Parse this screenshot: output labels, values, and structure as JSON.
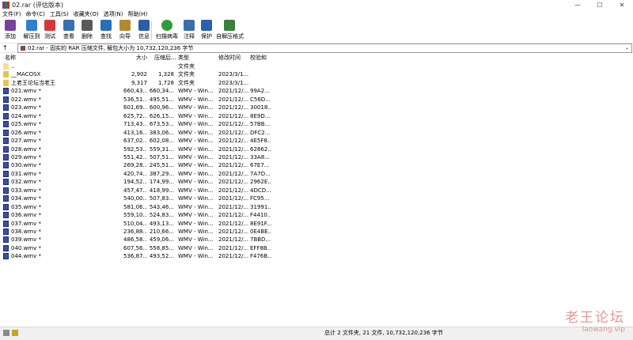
{
  "window": {
    "title": "02.rar (评估版本)"
  },
  "window_buttons": {
    "minimize": "—",
    "maximize": "☐",
    "close": "✕"
  },
  "menu": [
    "文件(F)",
    "命令(C)",
    "工具(S)",
    "收藏夹(O)",
    "选项(N)",
    "帮助(H)"
  ],
  "toolbar": [
    {
      "label": "添加",
      "icon": "add-archive-icon",
      "color": "#7b3fa0"
    },
    {
      "label": "解压到",
      "icon": "extract-to-icon",
      "color": "#2f7fd0"
    },
    {
      "label": "测试",
      "icon": "test-icon",
      "color": "#d13b3b"
    },
    {
      "label": "查看",
      "icon": "view-icon",
      "color": "#3a6fb0"
    },
    {
      "label": "删除",
      "icon": "delete-icon",
      "color": "#5a5a5a"
    },
    {
      "label": "查找",
      "icon": "find-icon",
      "color": "#2b6fb8"
    },
    {
      "label": "向导",
      "icon": "wizard-icon",
      "color": "#b08a2e"
    },
    {
      "label": "信息",
      "icon": "info-icon",
      "color": "#2b5fa8"
    },
    {
      "label": "扫描病毒",
      "icon": "virus-scan-icon",
      "color": "#2e9d3a"
    },
    {
      "label": "注释",
      "icon": "comment-icon",
      "color": "#3b6fa8"
    },
    {
      "label": "保护",
      "icon": "protect-icon",
      "color": "#2b5fb0"
    },
    {
      "label": "自解压格式",
      "icon": "sfx-icon",
      "color": "#3a7f3a"
    }
  ],
  "address": {
    "up": "↑",
    "text": "02.rar - 固实的 RAR 压缩文件, 解包大小为 10,732,120,236 字节",
    "chevron": "⌄"
  },
  "columns": [
    "名称",
    "大小",
    "压缩后...",
    "类型",
    "修改时间",
    "校验和"
  ],
  "rows": [
    {
      "icon": "parent",
      "name": "..",
      "size": "",
      "packed": "",
      "type": "文件夹",
      "modified": "",
      "crc": ""
    },
    {
      "icon": "folder",
      "name": "__MACOSX",
      "size": "2,902",
      "packed": "1,328",
      "type": "文件夹",
      "modified": "2023/3/1...",
      "crc": ""
    },
    {
      "icon": "folder",
      "name": "上老王论坛当老王",
      "size": "9,317",
      "packed": "1,728",
      "type": "文件夹",
      "modified": "2023/3/1...",
      "crc": ""
    },
    {
      "icon": "wmv",
      "name": "021.wmv *",
      "size": "660,43...",
      "packed": "660,34...",
      "type": "WMV - Win...",
      "modified": "2021/12/...",
      "crc": "99A2..."
    },
    {
      "icon": "wmv",
      "name": "022.wmv *",
      "size": "536,51...",
      "packed": "495,51...",
      "type": "WMV - Win...",
      "modified": "2021/12/...",
      "crc": "C56D..."
    },
    {
      "icon": "wmv",
      "name": "023.wmv *",
      "size": "601,69...",
      "packed": "600,96...",
      "type": "WMV - Win...",
      "modified": "2021/12/...",
      "crc": "30018..."
    },
    {
      "icon": "wmv",
      "name": "024.wmv *",
      "size": "625,72...",
      "packed": "626,15...",
      "type": "WMV - Win...",
      "modified": "2021/12/...",
      "crc": "8E9D..."
    },
    {
      "icon": "wmv",
      "name": "025.wmv *",
      "size": "713,43...",
      "packed": "673,53...",
      "type": "WMV - Win...",
      "modified": "2021/12/...",
      "crc": "57BB..."
    },
    {
      "icon": "wmv",
      "name": "026.wmv *",
      "size": "413,16...",
      "packed": "383,06...",
      "type": "WMV - Win...",
      "modified": "2021/12/...",
      "crc": "DFC2..."
    },
    {
      "icon": "wmv",
      "name": "027.wmv *",
      "size": "637,02...",
      "packed": "602,08...",
      "type": "WMV - Win...",
      "modified": "2021/12/...",
      "crc": "4E5F8..."
    },
    {
      "icon": "wmv",
      "name": "028.wmv *",
      "size": "592,53...",
      "packed": "559,31...",
      "type": "WMV - Win...",
      "modified": "2021/12/...",
      "crc": "62862..."
    },
    {
      "icon": "wmv",
      "name": "029.wmv *",
      "size": "551,42...",
      "packed": "507,51...",
      "type": "WMV - Win...",
      "modified": "2021/12/...",
      "crc": "33A8..."
    },
    {
      "icon": "wmv",
      "name": "030.wmv *",
      "size": "269,28...",
      "packed": "245,51...",
      "type": "WMV - Win...",
      "modified": "2021/12/...",
      "crc": "67E7..."
    },
    {
      "icon": "wmv",
      "name": "031.wmv *",
      "size": "420,74...",
      "packed": "387,29...",
      "type": "WMV - Win...",
      "modified": "2021/12/...",
      "crc": "7A7D..."
    },
    {
      "icon": "wmv",
      "name": "032.wmv *",
      "size": "194,52...",
      "packed": "174,99...",
      "type": "WMV - Win...",
      "modified": "2021/12/...",
      "crc": "2962E..."
    },
    {
      "icon": "wmv",
      "name": "033.wmv *",
      "size": "457,47...",
      "packed": "418,99...",
      "type": "WMV - Win...",
      "modified": "2021/12/...",
      "crc": "4DCD..."
    },
    {
      "icon": "wmv",
      "name": "034.wmv *",
      "size": "540,00...",
      "packed": "507,83...",
      "type": "WMV - Win...",
      "modified": "2021/12/...",
      "crc": "FC95..."
    },
    {
      "icon": "wmv",
      "name": "035.wmv *",
      "size": "581,06...",
      "packed": "543,46...",
      "type": "WMV - Win...",
      "modified": "2021/12/...",
      "crc": "31991..."
    },
    {
      "icon": "wmv",
      "name": "036.wmv *",
      "size": "559,10...",
      "packed": "524,83...",
      "type": "WMV - Win...",
      "modified": "2021/12/...",
      "crc": "F4410..."
    },
    {
      "icon": "wmv",
      "name": "037.wmv *",
      "size": "510,04...",
      "packed": "493,13...",
      "type": "WMV - Win...",
      "modified": "2021/12/...",
      "crc": "8E91F..."
    },
    {
      "icon": "wmv",
      "name": "038.wmv *",
      "size": "236,88...",
      "packed": "210,66...",
      "type": "WMV - Win...",
      "modified": "2021/12/...",
      "crc": "0E4BE..."
    },
    {
      "icon": "wmv",
      "name": "039.wmv *",
      "size": "486,58...",
      "packed": "459,06...",
      "type": "WMV - Win...",
      "modified": "2021/12/...",
      "crc": "7BBD..."
    },
    {
      "icon": "wmv",
      "name": "040.wmv *",
      "size": "607,56...",
      "packed": "558,85...",
      "type": "WMV - Win...",
      "modified": "2021/12/...",
      "crc": "EFF8B..."
    },
    {
      "icon": "wmv",
      "name": "044.wmv *",
      "size": "536,87...",
      "packed": "493,52...",
      "type": "WMV - Win...",
      "modified": "2021/12/...",
      "crc": "F476B..."
    }
  ],
  "status": {
    "text": "总计 2 文件夹, 21 文件, 10,732,120,236 字节"
  },
  "watermark": {
    "title": "老王论坛",
    "url": "laowang.vip"
  }
}
